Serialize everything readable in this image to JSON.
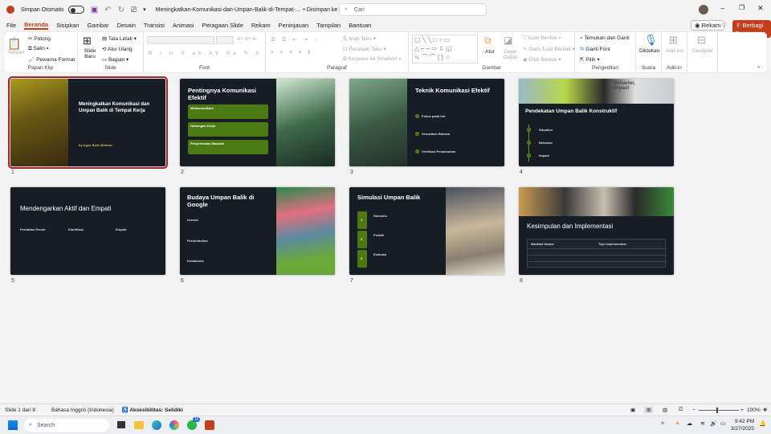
{
  "titlebar": {
    "autosave": "Simpan Otomatis",
    "filename": "Meningkatkan-Komunikasi-dan-Umpan-Balik-di-Tempat-...",
    "saved": "• Disimpan ke PC ini",
    "search_placeholder": "Cari"
  },
  "tabs": [
    "File",
    "Beranda",
    "Sisipkan",
    "Gambar",
    "Desain",
    "Transisi",
    "Animasi",
    "Peragaan Slide",
    "Rekam",
    "Peninjauan",
    "Tampilan",
    "Bantuan"
  ],
  "actions": {
    "record": "Rekam",
    "share": "Berbagi"
  },
  "ribbon": {
    "clipboard": {
      "paste": "Tempel",
      "cut": "Potong",
      "copy": "Salin",
      "format": "Pewarna Format",
      "label": "Papan Klip"
    },
    "slides": {
      "new": "Slide Baru",
      "layout": "Tata Letak",
      "reset": "Atur Ulang",
      "section": "Bagian",
      "label": "Slide"
    },
    "font": {
      "label": "Font"
    },
    "paragraph": {
      "direction": "Arah Teks",
      "align": "Perataan Teks",
      "smartart": "Konversi ke SmartArt",
      "label": "Paragraf"
    },
    "drawing": {
      "arrange": "Atur",
      "quick": "Gaya Cepat",
      "fill": "Isian Bentuk",
      "outline": "Garis Luar Bentuk",
      "effect": "Efek Bentuk",
      "label": "Gambar"
    },
    "editing": {
      "find": "Temukan dan Ganti",
      "replace": "Ganti Font",
      "select": "Pilih",
      "label": "Pengeditan"
    },
    "voice": {
      "dictate": "Diktekan",
      "label": "Suara"
    },
    "addin": {
      "addins": "Add-ins",
      "label": "Add-in"
    },
    "designer": {
      "label": "Designer"
    }
  },
  "slides": [
    {
      "num": "1",
      "title": "Meningkatkan Komunikasi dan Umpan Balik di Tempat Kerja",
      "author": "by Agus Budi Wiranto"
    },
    {
      "num": "2",
      "title": "Pentingnya Komunikasi Efektif",
      "items": [
        "Miskomunikasi",
        "Hubungan Kerja",
        "Penyelesaian Masalah"
      ]
    },
    {
      "num": "3",
      "title": "Teknik Komunikasi Efektif",
      "items": [
        "Fokus pada Inti",
        "Sesuaikan Bahasa",
        "Verifikasi Pemahaman"
      ]
    },
    {
      "num": "4",
      "title": "Pendekatan Umpan Balik Konstruktif",
      "image_text": "Behavior, Impact",
      "items": [
        "Situation",
        "Behavior",
        "Impact"
      ]
    },
    {
      "num": "5",
      "title": "Mendengarkan Aktif dan Empati",
      "items": [
        "Perhatian Penuh",
        "Klarifikasi",
        "Empati"
      ]
    },
    {
      "num": "6",
      "title": "Budaya Umpan Balik di Google",
      "items": [
        "Inovasi",
        "Pertumbuhan",
        "Kolaborasi"
      ]
    },
    {
      "num": "7",
      "title": "Simulasi Umpan Balik",
      "items": [
        "Skenario",
        "Praktik",
        "Evaluasi"
      ],
      "steps": [
        "1",
        "2",
        "3"
      ]
    },
    {
      "num": "8",
      "title": "Kesimpulan dan Implementasi",
      "table_header": [
        "Manfaat Utama",
        "Tips Implementasi"
      ]
    }
  ],
  "status": {
    "slide": "Slide 1 dari 8",
    "language": "Bahasa Inggris (Indonesia)",
    "accessibility": "Aksesibilitas: Selidiki",
    "zoom": "100%"
  },
  "taskbar": {
    "search": "Search",
    "time": "9:42 PM",
    "date": "3/27/2025",
    "whatsapp_badge": "11"
  },
  "colors": {
    "accent": "#c43e1c",
    "slide_bg": "#161d24",
    "green": "#4b7a12"
  }
}
